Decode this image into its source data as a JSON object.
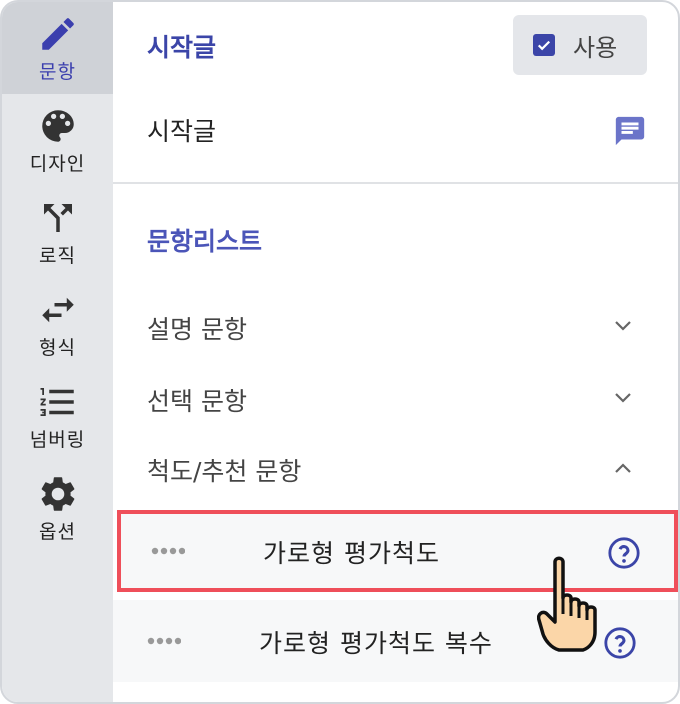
{
  "rail": {
    "items": [
      {
        "label": "문항",
        "icon": "pencil-icon",
        "active": true
      },
      {
        "label": "디자인",
        "icon": "palette-icon",
        "active": false
      },
      {
        "label": "로직",
        "icon": "fork-arrow-icon",
        "active": false
      },
      {
        "label": "형식",
        "icon": "swap-arrows-icon",
        "active": false
      },
      {
        "label": "넘버링",
        "icon": "numbered-list-icon",
        "active": false
      },
      {
        "label": "옵션",
        "icon": "gear-icon",
        "active": false
      }
    ]
  },
  "intro": {
    "section_title": "시작글",
    "use_label": "사용",
    "use_checked": true,
    "row_label": "시작글"
  },
  "list": {
    "title": "문항리스트",
    "categories": [
      {
        "label": "설명 문항",
        "expanded": false
      },
      {
        "label": "선택 문항",
        "expanded": false
      },
      {
        "label": "척도/추천 문항",
        "expanded": true
      }
    ],
    "items": [
      {
        "label": "가로형 평가척도",
        "highlighted": true
      },
      {
        "label": "가로형 평가척도 복수",
        "highlighted": false
      }
    ]
  },
  "colors": {
    "accent": "#3b45a8",
    "highlight_border": "#ef4f5a",
    "rail_bg": "#e5e7ea"
  }
}
